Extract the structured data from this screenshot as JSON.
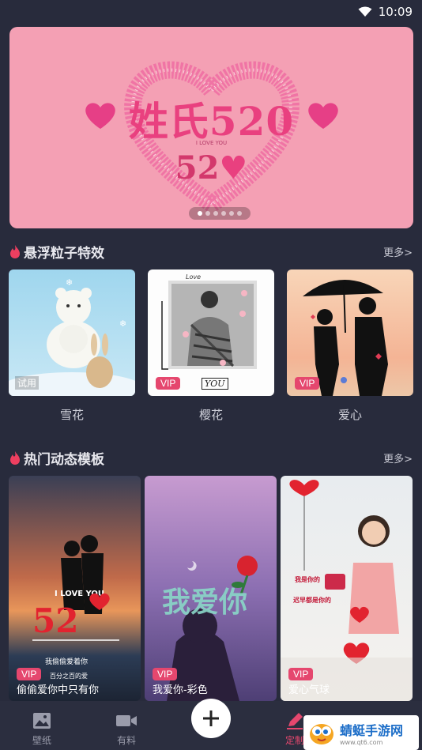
{
  "status": {
    "time": "10:09"
  },
  "banner": {
    "title": "姓氏520",
    "subtitle": "52",
    "tagline": "I LOVE YOU",
    "dots": [
      true,
      false,
      false,
      false,
      false,
      false
    ]
  },
  "section_effects": {
    "title": "悬浮粒子特效",
    "more": "更多>",
    "cards": [
      {
        "label": "雪花",
        "badge": "试用"
      },
      {
        "label": "樱花",
        "badge": "VIP",
        "caption": "YOU"
      },
      {
        "label": "爱心",
        "badge": "VIP"
      }
    ]
  },
  "section_templates": {
    "title": "热门动态模板",
    "more": "更多>",
    "cards": [
      {
        "name": "偷偷爱你中只有你",
        "badge": "VIP",
        "text_overlay": "I LOVE YOU",
        "text_lines": [
          "我偷偷爱着你",
          "百分之百的爱"
        ]
      },
      {
        "name": "我爱你-彩色",
        "badge": "VIP",
        "text_overlay": "我爱你"
      },
      {
        "name": "爱心气球",
        "badge": "VIP",
        "text_lines": [
          "我是你的",
          "迟早都是你的"
        ]
      }
    ]
  },
  "bottom_nav": {
    "items": [
      {
        "label": "壁纸",
        "icon": "image-icon"
      },
      {
        "label": "有料",
        "icon": "video-icon"
      },
      {
        "label": "定制",
        "icon": "pen-icon"
      }
    ]
  },
  "watermark": {
    "text": "蜻蜓手游网",
    "url": "www.qt6.com"
  }
}
